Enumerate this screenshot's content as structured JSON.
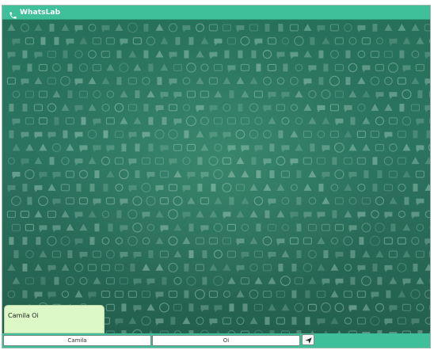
{
  "app": {
    "title": "WhatsLab",
    "icon": "phone-icon",
    "accent_color": "#3fbf9a",
    "chat_background_color": "#2a6e58"
  },
  "messages": [
    {
      "sender": "Camila",
      "text": "Oi",
      "display": "Camila Oi",
      "bubble_color": "#dcf8c6"
    }
  ],
  "composer": {
    "name_value": "Camila",
    "message_value": "Oi",
    "send_icon": "send-icon"
  }
}
